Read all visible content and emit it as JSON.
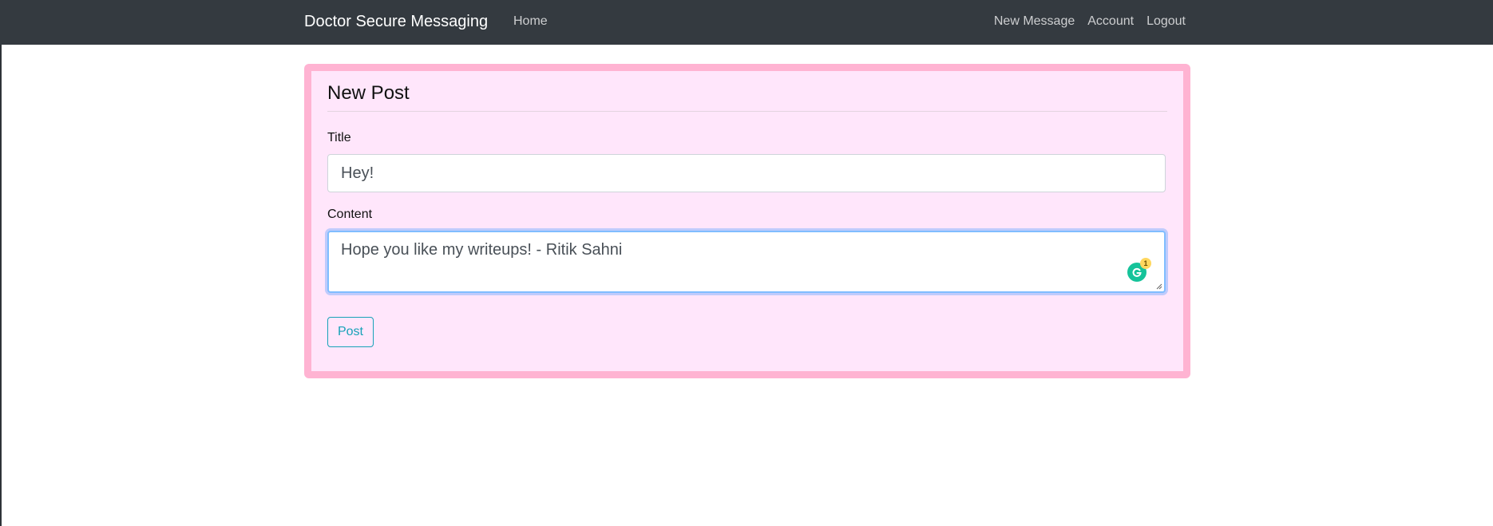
{
  "navbar": {
    "brand": "Doctor Secure Messaging",
    "home": "Home",
    "new_message": "New Message",
    "account": "Account",
    "logout": "Logout"
  },
  "form": {
    "legend": "New Post",
    "title_label": "Title",
    "title_value": "Hey!",
    "content_label": "Content",
    "content_value": "Hope you like my writeups! - Ritik Sahni",
    "submit_label": "Post"
  },
  "grammarly": {
    "icon": "grammarly-icon",
    "alert_count": "1"
  },
  "colors": {
    "navbar_bg": "#343a40",
    "card_bg": "#ffe6fb",
    "card_border": "#ffb3d2",
    "button_accent": "#17a2b8",
    "grammarly_green": "#15c39a"
  }
}
